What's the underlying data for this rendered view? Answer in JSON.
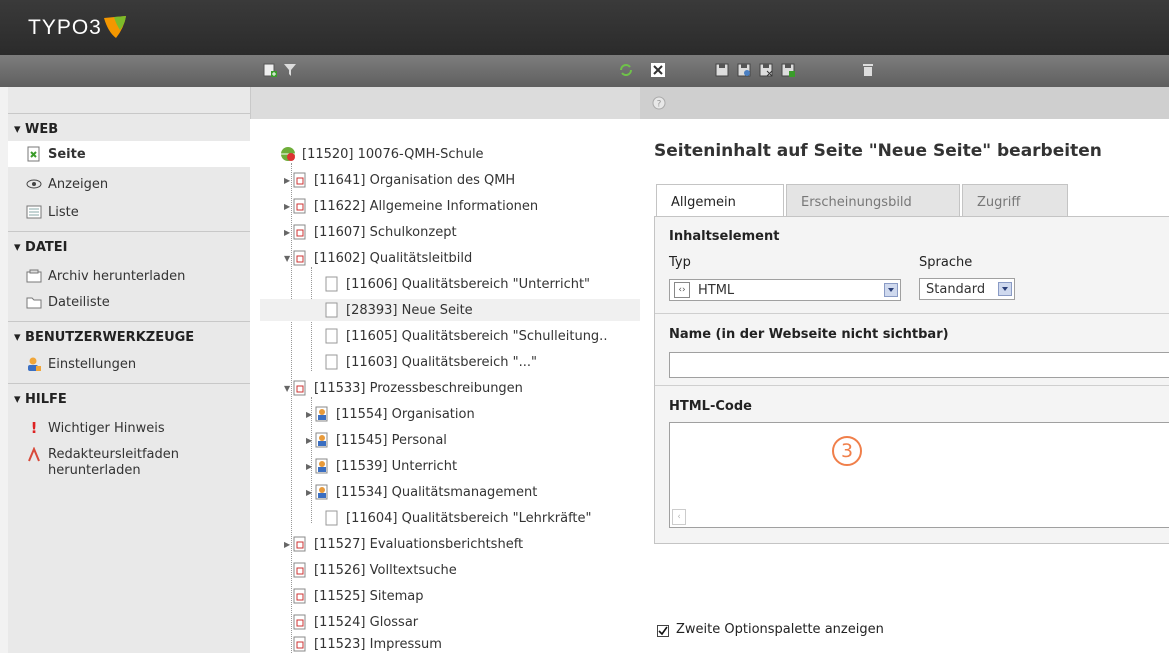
{
  "app": {
    "logo_text": "TYPO3"
  },
  "module_menu": {
    "groups": [
      {
        "label": "▾ WEB",
        "items": [
          {
            "label": "Seite",
            "icon": "page-module-icon"
          },
          {
            "label": "Anzeigen",
            "icon": "eye-icon"
          },
          {
            "label": "Liste",
            "icon": "list-icon"
          }
        ]
      },
      {
        "label": "▾ DATEI",
        "items": [
          {
            "label": "Archiv herunterladen",
            "icon": "archive-icon"
          },
          {
            "label": "Dateiliste",
            "icon": "folder-icon"
          }
        ]
      },
      {
        "label": "▾ BENUTZERWERKZEUGE",
        "items": [
          {
            "label": "Einstellungen",
            "icon": "user-settings-icon"
          }
        ]
      },
      {
        "label": "▾ HILFE",
        "items": [
          {
            "label": "Wichtiger Hinweis",
            "icon": "exclamation-icon"
          },
          {
            "label": "Redakteursleitfaden herunterladen",
            "icon": "pdf-icon"
          }
        ]
      }
    ]
  },
  "tree": {
    "root": "[11520] 10076-QMH-Schule",
    "nodes": [
      "[11641] Organisation des QMH",
      "[11622] Allgemeine Informationen",
      "[11607] Schulkonzept",
      "[11602] Qualitätsleitbild",
      "[11606] Qualitätsbereich \"Unterricht\"",
      "[28393] Neue Seite",
      "[11605] Qualitätsbereich \"Schulleitung..",
      "[11603] Qualitätsbereich \"...\"",
      "[11533] Prozessbeschreibungen",
      "[11554] Organisation",
      "[11545] Personal",
      "[11539] Unterricht",
      "[11534] Qualitätsmanagement",
      "[11604] Qualitätsbereich \"Lehrkräfte\"",
      "[11527] Evaluationsberichtsheft",
      "[11526] Volltextsuche",
      "[11525] Sitemap",
      "[11524] Glossar",
      "[11523] Impressum"
    ]
  },
  "content": {
    "title": "Seiteninhalt auf Seite \"Neue Seite\" bearbeiten",
    "tabs": [
      "Allgemein",
      "Erscheinungsbild",
      "Zugriff"
    ],
    "section_inhalt": "Inhaltselement",
    "typ_label": "Typ",
    "typ_value": "HTML",
    "sprache_label": "Sprache",
    "sprache_value": "Standard",
    "name_label": "Name (in der Webseite nicht sichtbar)",
    "name_value": "",
    "html_label": "HTML-Code",
    "html_value": "",
    "badge": "3",
    "option_label": "Zweite Optionspalette anzeigen",
    "option_checked": true
  },
  "colors": {
    "topbar": "#2b2b2b",
    "toolbar": "#6b6b6b",
    "badge": "#f07f4a",
    "logo_orange": "#f49700"
  }
}
